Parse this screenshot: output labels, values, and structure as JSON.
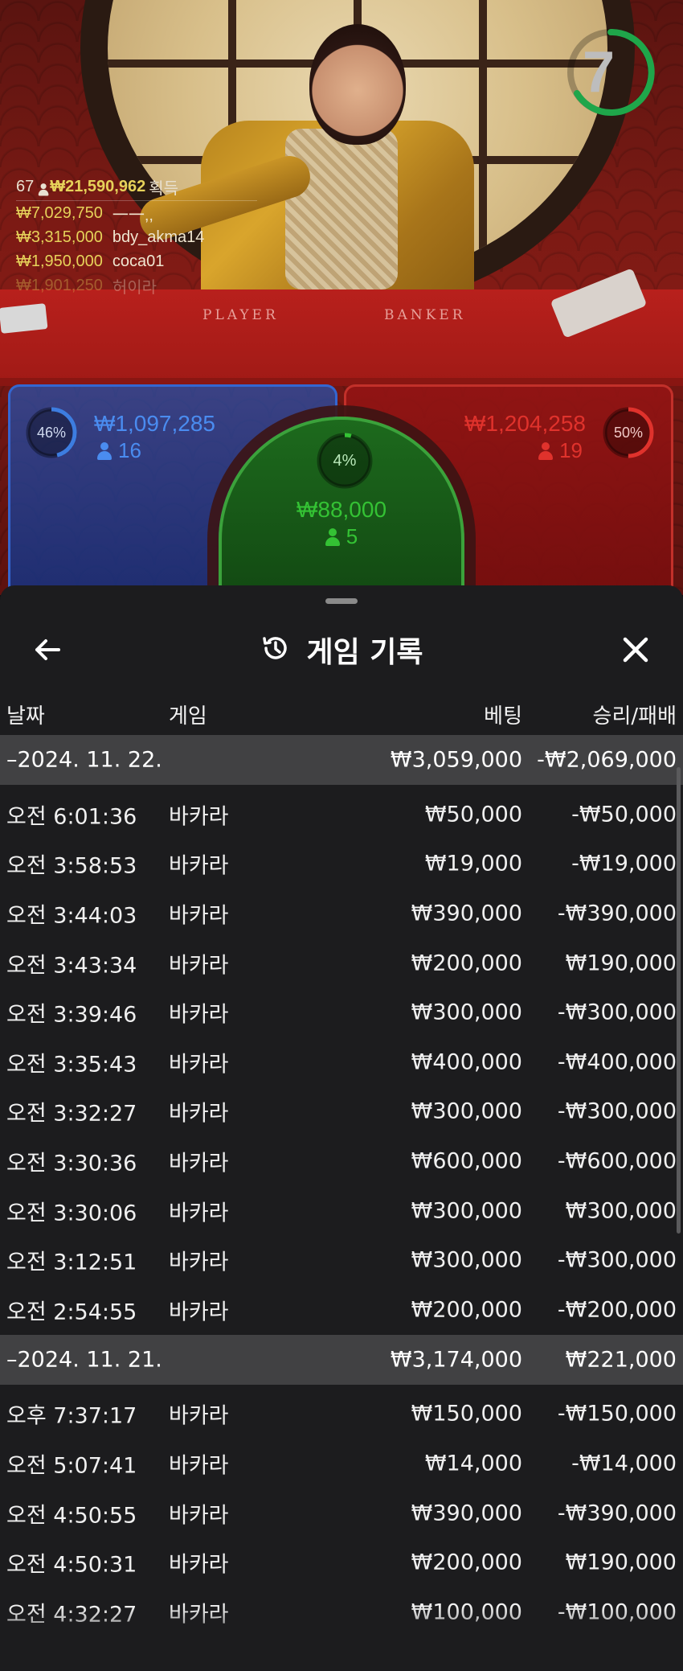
{
  "timer": {
    "value": "7",
    "color": "#1fa64a"
  },
  "winners": {
    "count": "67",
    "total": "₩21,590,962",
    "total_label": "획득",
    "rows": [
      {
        "amount": "₩7,029,750",
        "name": "一一,,"
      },
      {
        "amount": "₩3,315,000",
        "name": "bdy_akma14"
      },
      {
        "amount": "₩1,950,000",
        "name": "coca01"
      },
      {
        "amount": "₩1,901,250",
        "name": "허이라"
      }
    ]
  },
  "table_labels": {
    "player": "PLAYER",
    "banker": "BANKER"
  },
  "bets": {
    "player": {
      "percent": "46%",
      "amount": "₩1,097,285",
      "count": "16",
      "color": "#3d7de0"
    },
    "tie": {
      "percent": "4%",
      "amount": "₩88,000",
      "count": "5",
      "color": "#34c234"
    },
    "banker": {
      "percent": "50%",
      "amount": "₩1,204,258",
      "count": "19",
      "color": "#e0322c"
    }
  },
  "sheet": {
    "title": "게임 기록",
    "icons": {
      "back": "arrow-left-icon",
      "history": "history-icon",
      "close": "close-icon"
    },
    "columns": {
      "date": "날짜",
      "game": "게임",
      "bet": "베팅",
      "win": "승리/패배"
    },
    "groups": [
      {
        "date": "–2024. 11. 22.",
        "bet_total": "₩3,059,000",
        "win_total": "-₩2,069,000",
        "rows": [
          {
            "time": "오전 6:01:36",
            "game": "바카라",
            "bet": "₩50,000",
            "win": "-₩50,000"
          },
          {
            "time": "오전 3:58:53",
            "game": "바카라",
            "bet": "₩19,000",
            "win": "-₩19,000"
          },
          {
            "time": "오전 3:44:03",
            "game": "바카라",
            "bet": "₩390,000",
            "win": "-₩390,000"
          },
          {
            "time": "오전 3:43:34",
            "game": "바카라",
            "bet": "₩200,000",
            "win": "₩190,000"
          },
          {
            "time": "오전 3:39:46",
            "game": "바카라",
            "bet": "₩300,000",
            "win": "-₩300,000"
          },
          {
            "time": "오전 3:35:43",
            "game": "바카라",
            "bet": "₩400,000",
            "win": "-₩400,000"
          },
          {
            "time": "오전 3:32:27",
            "game": "바카라",
            "bet": "₩300,000",
            "win": "-₩300,000"
          },
          {
            "time": "오전 3:30:36",
            "game": "바카라",
            "bet": "₩600,000",
            "win": "-₩600,000"
          },
          {
            "time": "오전 3:30:06",
            "game": "바카라",
            "bet": "₩300,000",
            "win": "₩300,000"
          },
          {
            "time": "오전 3:12:51",
            "game": "바카라",
            "bet": "₩300,000",
            "win": "-₩300,000"
          },
          {
            "time": "오전 2:54:55",
            "game": "바카라",
            "bet": "₩200,000",
            "win": "-₩200,000"
          }
        ]
      },
      {
        "date": "–2024. 11. 21.",
        "bet_total": "₩3,174,000",
        "win_total": "₩221,000",
        "rows": [
          {
            "time": "오후 7:37:17",
            "game": "바카라",
            "bet": "₩150,000",
            "win": "-₩150,000"
          },
          {
            "time": "오전 5:07:41",
            "game": "바카라",
            "bet": "₩14,000",
            "win": "-₩14,000"
          },
          {
            "time": "오전 4:50:55",
            "game": "바카라",
            "bet": "₩390,000",
            "win": "-₩390,000"
          },
          {
            "time": "오전 4:50:31",
            "game": "바카라",
            "bet": "₩200,000",
            "win": "₩190,000"
          },
          {
            "time": "오전 4:32:27",
            "game": "바카라",
            "bet": "₩100,000",
            "win": "-₩100,000"
          }
        ]
      }
    ]
  }
}
